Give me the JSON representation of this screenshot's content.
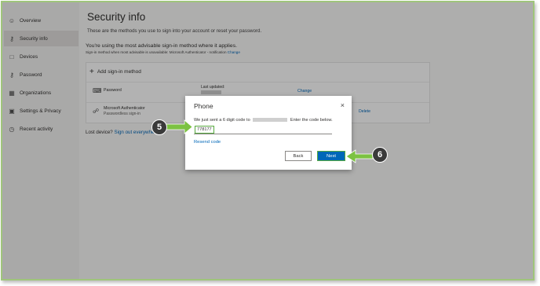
{
  "sidebar": {
    "items": [
      {
        "label": "Overview",
        "icon": "person-icon"
      },
      {
        "label": "Security info",
        "icon": "key-icon"
      },
      {
        "label": "Devices",
        "icon": "laptop-icon"
      },
      {
        "label": "Password",
        "icon": "key-icon"
      },
      {
        "label": "Organizations",
        "icon": "briefcase-icon"
      },
      {
        "label": "Settings & Privacy",
        "icon": "lock-icon"
      },
      {
        "label": "Recent activity",
        "icon": "history-icon"
      }
    ]
  },
  "main": {
    "title": "Security info",
    "subtitle": "These are the methods you use to sign into your account or reset your password.",
    "advisable": "You're using the most advisable sign-in method where it applies.",
    "fallback_text": "Sign-in method when most advisable is unavailable: Microsoft Authenticator - notification",
    "fallback_change": "Change",
    "add_method": "Add sign-in method",
    "methods": [
      {
        "name": "Password",
        "last_updated_label": "Last updated:",
        "action": "Change"
      },
      {
        "name": "Microsoft Authenticator",
        "detail": "Passwordless sign-in",
        "action": "Delete"
      }
    ],
    "lost_device": "Lost device?",
    "lost_link": "Sign out everywhere"
  },
  "dialog": {
    "title": "Phone",
    "close": "×",
    "message_prefix": "We just sent a 6 digit code to",
    "message_suffix": "Enter the code below.",
    "code_value": "778177",
    "resend": "Resend code",
    "back": "Back",
    "next": "Next"
  },
  "annotations": {
    "step5": "5",
    "step6": "6",
    "arrow_color": "#7cc242",
    "highlight_color": "#57a93f"
  }
}
